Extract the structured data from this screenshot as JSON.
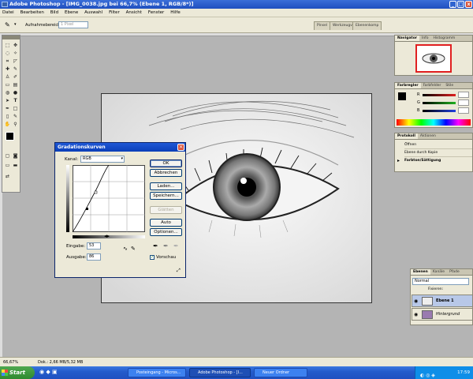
{
  "window": {
    "title": "Adobe Photoshop - [IMG_0038.jpg bei 66,7% (Ebene 1, RGB/8*)]",
    "controls": [
      "_",
      "□",
      "x"
    ]
  },
  "menu": [
    "Datei",
    "Bearbeiten",
    "Bild",
    "Ebene",
    "Auswahl",
    "Filter",
    "Ansicht",
    "Fenster",
    "Hilfe"
  ],
  "options_bar": {
    "label": "Aufnahmebereich:",
    "value": "1 Pixel",
    "well_tabs": [
      "Pinsel",
      "Werkzeugvo",
      "Ebenenkomp"
    ]
  },
  "navigator": {
    "tabs": [
      "Navigator",
      "Info",
      "Histogramm"
    ]
  },
  "color_panel": {
    "tabs": [
      "Farbregler",
      "Farbfelder",
      "Stile"
    ],
    "channels": [
      {
        "label": "R",
        "color": "#e02020"
      },
      {
        "label": "G",
        "color": "#20b020"
      },
      {
        "label": "B",
        "color": "#2040e0"
      }
    ]
  },
  "history_panel": {
    "tabs": [
      "Protokoll",
      "Aktionen"
    ],
    "items": [
      "Öffnen",
      "Ebene durch Kopie",
      "Farbton/Sättigung"
    ]
  },
  "curves_dialog": {
    "title": "Gradationskurven",
    "channel_label": "Kanal:",
    "channel_value": "RGB",
    "input_label": "Eingabe:",
    "input_value": "53",
    "output_label": "Ausgabe:",
    "output_value": "86",
    "buttons": {
      "ok": "OK",
      "cancel": "Abbrechen",
      "load": "Laden...",
      "save": "Speichern...",
      "smooth": "Glätten",
      "auto": "Auto",
      "options": "Optionen..."
    },
    "preview_label": "Vorschau",
    "preview_checked": true
  },
  "layers_panel": {
    "tabs": [
      "Ebenen",
      "Kanäle",
      "Pfade"
    ],
    "blend_mode": "Normal",
    "lock_label": "Fixieren:",
    "layers": [
      {
        "name": "Ebene 1",
        "selected": true
      },
      {
        "name": "Hintergrund",
        "selected": false
      }
    ]
  },
  "status_bar": {
    "zoom": "66,67%",
    "doc": "Dok.: 2,66 MB/5,32 MB"
  },
  "taskbar": {
    "start": "Start",
    "tasks": [
      "Posteingang - Micros...",
      "Adobe Photoshop - [I...",
      "Neuer Ordner"
    ],
    "clock": "17:59"
  }
}
